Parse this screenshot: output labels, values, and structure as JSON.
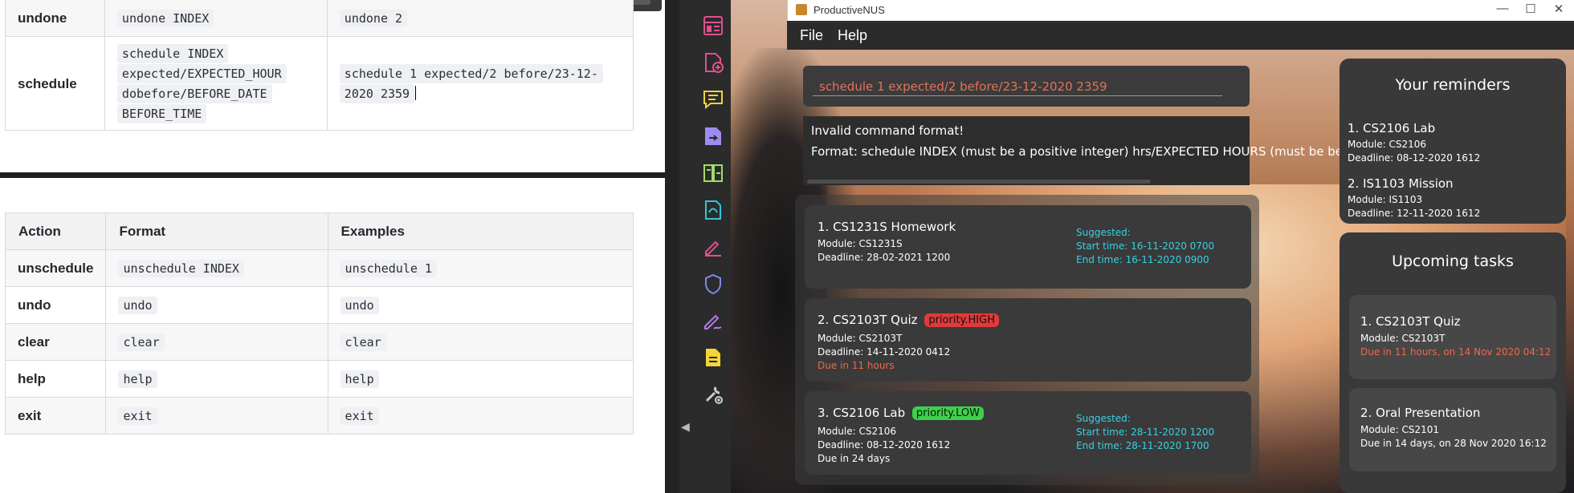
{
  "doc": {
    "top_table": {
      "rows": [
        {
          "action": "undone",
          "format": "undone INDEX",
          "example": "undone 2"
        },
        {
          "action": "schedule",
          "format_lines": [
            "schedule INDEX",
            "expected/EXPECTED_HOUR",
            "dobefore/BEFORE_DATE",
            "BEFORE_TIME"
          ],
          "example_lines": [
            "schedule 1 expected/2 before/23-12-",
            "2020 2359"
          ]
        }
      ]
    },
    "bottom_table": {
      "headers": [
        "Action",
        "Format",
        "Examples"
      ],
      "rows": [
        {
          "action": "unschedule",
          "format": "unschedule INDEX",
          "example": "unschedule 1"
        },
        {
          "action": "undo",
          "format": "undo",
          "example": "undo"
        },
        {
          "action": "clear",
          "format": "clear",
          "example": "clear"
        },
        {
          "action": "help",
          "format": "help",
          "example": "help"
        },
        {
          "action": "exit",
          "format": "exit",
          "example": "exit"
        }
      ]
    }
  },
  "toolbar": {
    "icons": [
      "layout-icon",
      "add-file-icon",
      "comment-icon",
      "export-icon",
      "organize-icon",
      "convert-icon",
      "sign-icon",
      "protect-icon",
      "fill-sign-icon",
      "document-icon",
      "tools-icon"
    ],
    "icon_colors": [
      "#e0508e",
      "#e0508e",
      "#f5d33a",
      "#9d8cf0",
      "#9fdc6a",
      "#31c5d8",
      "#e0508e",
      "#7a8cf0",
      "#b57ae8",
      "#f5d33a",
      "#cccccc"
    ]
  },
  "app": {
    "window_title": "ProductiveNUS",
    "menu": [
      "File",
      "Help"
    ],
    "command_input": "schedule 1 expected/2 before/23-12-2020 2359",
    "result": [
      "Invalid command format!",
      "Format: schedule INDEX (must be a positive integer) hrs/EXPECTED HOURS (must be be"
    ],
    "tasks": [
      {
        "title": "1.  CS1231S Homework",
        "module": "Module: CS1231S",
        "deadline": "Deadline: 28-02-2021 1200",
        "suggested": "Suggested:",
        "start": "Start time: 16-11-2020 0700",
        "end": "End time: 16-11-2020 0900"
      },
      {
        "title": "2.  CS2103T Quiz",
        "priority": "priority.HIGH",
        "module": "Module: CS2103T",
        "deadline": "Deadline: 14-11-2020 0412",
        "due": "Due in 11 hours"
      },
      {
        "title": "3.  CS2106 Lab",
        "priority": "priority.LOW",
        "module": "Module: CS2106",
        "deadline": "Deadline: 08-12-2020 1612",
        "due": "Due in 24 days",
        "suggested": "Suggested:",
        "start": "Start time: 28-11-2020 1200",
        "end": "End time: 28-11-2020 1700"
      }
    ],
    "reminders": {
      "header": "Your reminders",
      "items": [
        {
          "title": "1.  CS2106 Lab",
          "module": "Module: CS2106",
          "deadline": "Deadline: 08-12-2020 1612"
        },
        {
          "title": "2.  IS1103 Mission",
          "module": "Module: IS1103",
          "deadline": "Deadline: 12-11-2020 1612"
        }
      ]
    },
    "upcoming": {
      "header": "Upcoming tasks",
      "items": [
        {
          "title": "1.  CS2103T Quiz",
          "module": "Module: CS2103T",
          "due": "Due in 11 hours, on 14 Nov 2020 04:12"
        },
        {
          "title": "2.  Oral Presentation",
          "module": "Module: CS2101",
          "due": "Due in 14 days, on 28 Nov 2020 16:12"
        }
      ]
    }
  }
}
